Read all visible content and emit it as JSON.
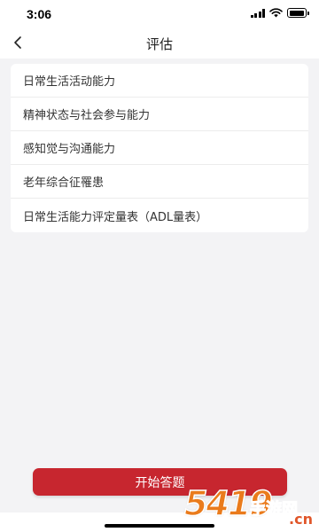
{
  "status_bar": {
    "time": "3:06",
    "icons": [
      "signal-icon",
      "wifi-icon",
      "battery-icon"
    ]
  },
  "header": {
    "back_icon": "chevron-left-icon",
    "title": "评估"
  },
  "assessment_list": {
    "items": [
      {
        "label": "日常生活活动能力"
      },
      {
        "label": "精神状态与社会参与能力"
      },
      {
        "label": "感知觉与沟通能力"
      },
      {
        "label": "老年综合征罹患"
      },
      {
        "label": "日常生活能力评定量表（ADL量表）"
      }
    ]
  },
  "footer": {
    "start_button_label": "开始答题"
  },
  "watermark": {
    "number": "5419",
    "text": "手游网",
    "domain": ".cn"
  },
  "colors": {
    "accent": "#c7262f",
    "background": "#f3f3f5",
    "card": "#ffffff"
  }
}
